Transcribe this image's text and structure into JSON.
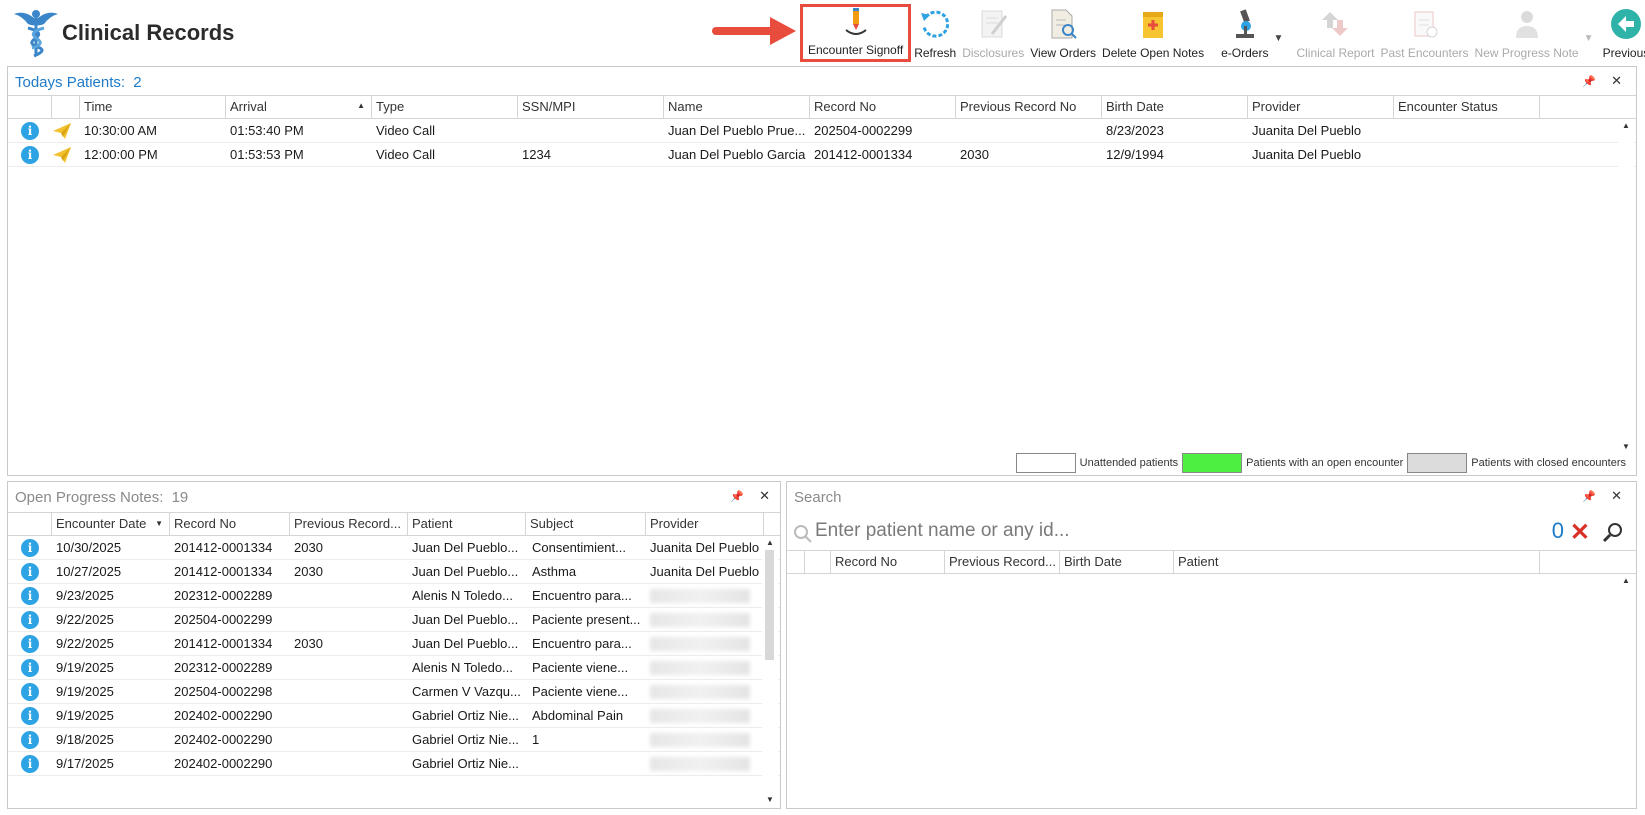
{
  "app": {
    "title": "Clinical Records"
  },
  "toolbar": {
    "buttons": [
      {
        "label": "Encounter Signoff",
        "enabled": true,
        "highlighted": true
      },
      {
        "label": "Refresh",
        "enabled": true
      },
      {
        "label": "Disclosures",
        "enabled": false
      },
      {
        "label": "View Orders",
        "enabled": true
      },
      {
        "label": "Delete Open Notes",
        "enabled": true
      },
      {
        "label": "e-Orders",
        "enabled": true,
        "has_dropdown": true
      },
      {
        "label": "Clinical Report",
        "enabled": false
      },
      {
        "label": "Past Encounters",
        "enabled": false
      },
      {
        "label": "New Progress Note",
        "enabled": false,
        "has_dropdown": true
      },
      {
        "label": "Previous",
        "enabled": true
      }
    ]
  },
  "todays_patients": {
    "title": "Todays Patients:",
    "count": "2",
    "columns": [
      "Time",
      "Arrival",
      "Type",
      "SSN/MPI",
      "Name",
      "Record No",
      "Previous Record No",
      "Birth Date",
      "Provider",
      "Encounter Status"
    ],
    "rows": [
      {
        "time": "10:30:00 AM",
        "arrival": "01:53:40 PM",
        "type": "Video Call",
        "ssn": "",
        "name": "Juan Del Pueblo Prue...",
        "record_no": "202504-0002299",
        "prev_record_no": "",
        "birth_date": "8/23/2023",
        "provider": "Juanita Del Pueblo",
        "status": ""
      },
      {
        "time": "12:00:00 PM",
        "arrival": "01:53:53 PM",
        "type": "Video Call",
        "ssn": "1234",
        "name": "Juan Del Pueblo Garcia",
        "record_no": "201412-0001334",
        "prev_record_no": "2030",
        "birth_date": "12/9/1994",
        "provider": "Juanita Del Pueblo",
        "status": ""
      }
    ],
    "legend": [
      {
        "label": "Unattended patients",
        "color": "#ffffff"
      },
      {
        "label": "Patients with an open encounter",
        "color": "#4cf040"
      },
      {
        "label": "Patients with closed encounters",
        "color": "#dcdcdc"
      }
    ]
  },
  "open_notes": {
    "title": "Open Progress Notes:",
    "count": "19",
    "columns": [
      "Encounter Date",
      "Record No",
      "Previous Record...",
      "Patient",
      "Subject",
      "Provider"
    ],
    "rows": [
      {
        "date": "10/30/2025",
        "record_no": "201412-0001334",
        "prev": "2030",
        "patient": "Juan Del Pueblo...",
        "subject": "Consentimient...",
        "provider": "Juanita Del Pueblo",
        "provider_hidden": false
      },
      {
        "date": "10/27/2025",
        "record_no": "201412-0001334",
        "prev": "2030",
        "patient": "Juan Del Pueblo...",
        "subject": "Asthma",
        "provider": "Juanita Del Pueblo",
        "provider_hidden": false
      },
      {
        "date": "9/23/2025",
        "record_no": "202312-0002289",
        "prev": "",
        "patient": "Alenis N Toledo...",
        "subject": "Encuentro para...",
        "provider": "",
        "provider_hidden": true
      },
      {
        "date": "9/22/2025",
        "record_no": "202504-0002299",
        "prev": "",
        "patient": "Juan Del Pueblo...",
        "subject": "Paciente present...",
        "provider": "",
        "provider_hidden": true
      },
      {
        "date": "9/22/2025",
        "record_no": "201412-0001334",
        "prev": "2030",
        "patient": "Juan Del Pueblo...",
        "subject": "Encuentro para...",
        "provider": "",
        "provider_hidden": true
      },
      {
        "date": "9/19/2025",
        "record_no": "202312-0002289",
        "prev": "",
        "patient": "Alenis N Toledo...",
        "subject": "Paciente viene...",
        "provider": "",
        "provider_hidden": true
      },
      {
        "date": "9/19/2025",
        "record_no": "202504-0002298",
        "prev": "",
        "patient": "Carmen V Vazqu...",
        "subject": "Paciente viene...",
        "provider": "",
        "provider_hidden": true
      },
      {
        "date": "9/19/2025",
        "record_no": "202402-0002290",
        "prev": "",
        "patient": "Gabriel Ortiz Nie...",
        "subject": "Abdominal Pain",
        "provider": "",
        "provider_hidden": true
      },
      {
        "date": "9/18/2025",
        "record_no": "202402-0002290",
        "prev": "",
        "patient": "Gabriel Ortiz Nie...",
        "subject": "1",
        "provider": "",
        "provider_hidden": true
      },
      {
        "date": "9/17/2025",
        "record_no": "202402-0002290",
        "prev": "",
        "patient": "Gabriel Ortiz Nie...",
        "subject": "",
        "provider": "",
        "provider_hidden": true
      }
    ]
  },
  "search": {
    "title": "Search",
    "placeholder": "Enter patient name or any id...",
    "count": "0",
    "columns": [
      "Record No",
      "Previous Record...",
      "Birth Date",
      "Patient"
    ]
  },
  "colors": {
    "accent": "#1e7bc8",
    "highlight": "#e74c3c",
    "info": "#2ea3e3"
  }
}
